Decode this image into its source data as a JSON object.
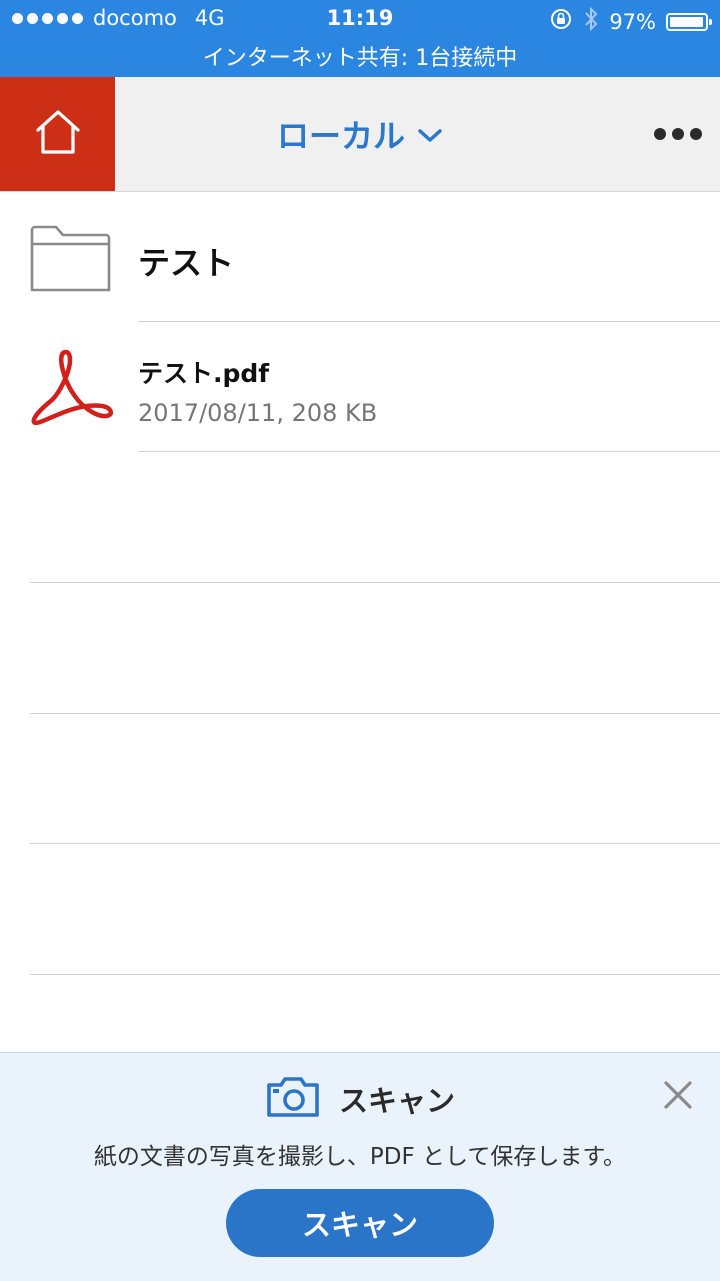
{
  "status_bar": {
    "carrier": "docomo",
    "network": "4G",
    "time": "11:19",
    "battery_percent_label": "97%",
    "battery_level": 0.97,
    "tethering_text": "インターネット共有: 1台接続中",
    "background_color": "#2a86e1"
  },
  "header": {
    "title": "ローカル",
    "accent_color": "#2a77cc",
    "home_color": "#cc2f16"
  },
  "files": [
    {
      "name": "テスト",
      "type": "folder",
      "icon": "folder-icon"
    },
    {
      "name": "テスト.pdf",
      "type": "pdf",
      "meta": "2017/08/11, 208 KB",
      "icon": "acrobat-pdf-icon"
    }
  ],
  "banner": {
    "title": "スキャン",
    "description": "紙の文書の写真を撮影し、PDF として保存します。",
    "button_label": "スキャン",
    "button_color": "#2a75c7"
  }
}
